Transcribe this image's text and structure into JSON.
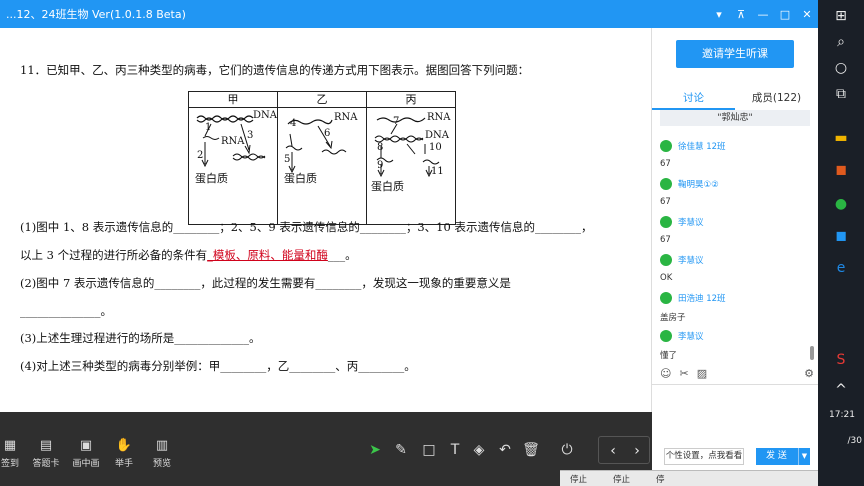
{
  "window": {
    "title": "...12、24班生物 Ver(1.0.1.8 Beta)",
    "controls": [
      "▾",
      "⊼",
      "—",
      "□",
      "✕"
    ]
  },
  "document": {
    "question_title": "11．已知甲、乙、丙三种类型的病毒，它们的遗传信息的传递方式用下图表示。据图回答下列问题：",
    "table": {
      "headers": [
        "甲",
        "乙",
        "丙"
      ],
      "jia": {
        "n1": "1",
        "n2": "2",
        "n3": "3",
        "dna": "DNA",
        "rna": "RNA",
        "protein": "蛋白质"
      },
      "yi": {
        "n4": "4",
        "n5": "5",
        "n6": "6",
        "rna": "RNA",
        "protein": "蛋白质"
      },
      "bing": {
        "n7": "7",
        "n8": "8",
        "n9": "9",
        "n10": "10",
        "n11": "11",
        "rna": "RNA",
        "dna": "DNA",
        "protein": "蛋白质"
      }
    },
    "q1_line1": "(1)图中 1、8 表示遗传信息的________；2、5、9 表示遗传信息的________；3、10 表示遗传信息的________，",
    "q1_line2_prefix": "以上 3 个过程的进行所必备的条件有",
    "q1_line2_answer": "_模板、原料、能量和酶",
    "q1_line2_suffix": "___。",
    "q2_line1": "(2)图中 7 表示遗传信息的________，此过程的发生需要有________，发现这一现象的重要意义是",
    "q2_line2": "______________。",
    "q3": "(3)上述生理过程进行的场所是_____________。",
    "q4": "(4)对上述三种类型的病毒分别举例：甲________，乙________、丙________。"
  },
  "toolbar": {
    "items": [
      {
        "label": "签到",
        "icon": "calendar-icon"
      },
      {
        "label": "答题卡",
        "icon": "card-icon"
      },
      {
        "label": "画中画",
        "icon": "pip-icon"
      },
      {
        "label": "举手",
        "icon": "hand-icon"
      },
      {
        "label": "预览",
        "icon": "preview-icon"
      }
    ],
    "prev": "‹",
    "next": "›"
  },
  "panel": {
    "invite_label": "邀请学生听课",
    "tabs": [
      {
        "label": "讨论",
        "active": true
      },
      {
        "label": "成员(122)",
        "active": false
      }
    ],
    "banner": "\"郭灿忠\"",
    "messages": [
      {
        "name": "徐佳慧 12班",
        "text": "67"
      },
      {
        "name": "鞠明昊①②",
        "text": "67"
      },
      {
        "name": "李慧议",
        "text": "67"
      },
      {
        "name": "李慧议",
        "text": "OK"
      },
      {
        "name": "田浩迪 12班",
        "text": "盖房子"
      },
      {
        "name": "李慧议",
        "text": "懂了"
      }
    ],
    "personal_label": "个性设置，点我看看",
    "send_label": "发 送"
  },
  "status_strip": {
    "items": [
      "停止",
      "停止",
      "停"
    ]
  },
  "taskbar": {
    "clock": "17:21",
    "day": "/30"
  },
  "colors": {
    "accent": "#2196f3",
    "wechat": "#2ab543",
    "answer": "#d0021b"
  }
}
